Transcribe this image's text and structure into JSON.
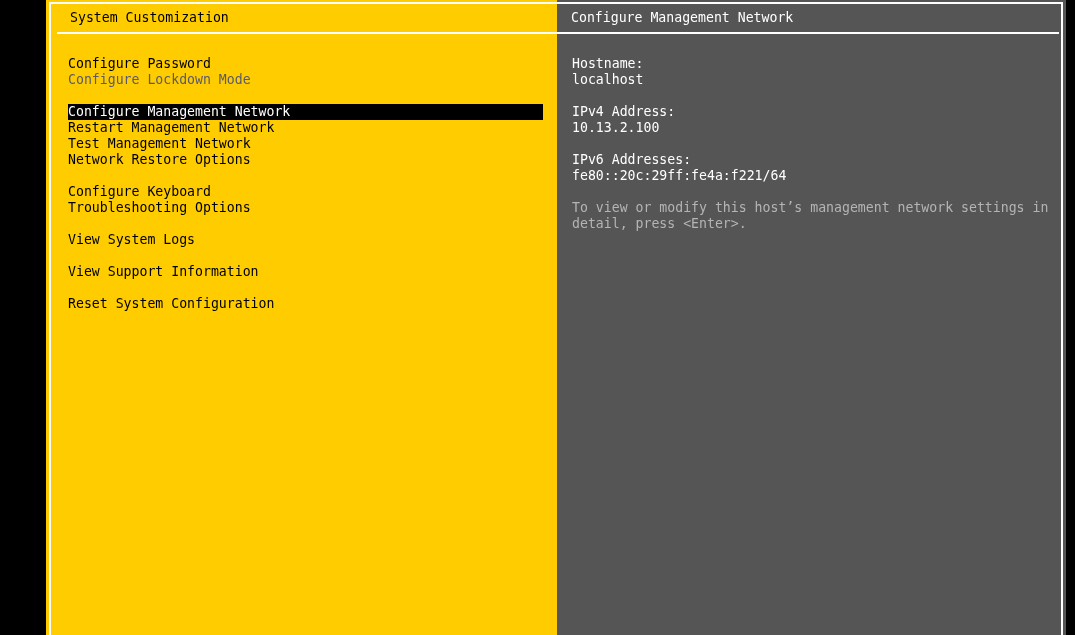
{
  "menu": {
    "title": "System Customization",
    "groups": [
      {
        "items": [
          {
            "label": "Configure Password",
            "disabled": false,
            "selected": false
          },
          {
            "label": "Configure Lockdown Mode",
            "disabled": true,
            "selected": false
          }
        ]
      },
      {
        "items": [
          {
            "label": "Configure Management Network",
            "disabled": false,
            "selected": true
          },
          {
            "label": "Restart Management Network",
            "disabled": false,
            "selected": false
          },
          {
            "label": "Test Management Network",
            "disabled": false,
            "selected": false
          },
          {
            "label": "Network Restore Options",
            "disabled": false,
            "selected": false
          }
        ]
      },
      {
        "items": [
          {
            "label": "Configure Keyboard",
            "disabled": false,
            "selected": false
          },
          {
            "label": "Troubleshooting Options",
            "disabled": false,
            "selected": false
          }
        ]
      },
      {
        "items": [
          {
            "label": "View System Logs",
            "disabled": false,
            "selected": false
          }
        ]
      },
      {
        "items": [
          {
            "label": "View Support Information",
            "disabled": false,
            "selected": false
          }
        ]
      },
      {
        "items": [
          {
            "label": "Reset System Configuration",
            "disabled": false,
            "selected": false
          }
        ]
      }
    ]
  },
  "details": {
    "title": "Configure Management Network",
    "fields": [
      {
        "label": "Hostname:",
        "value": "localhost"
      },
      {
        "label": "IPv4 Address:",
        "value": "10.13.2.100"
      },
      {
        "label": "IPv6 Addresses:",
        "value": "fe80::20c:29ff:fe4a:f221/64"
      }
    ],
    "hint": "To view or modify this host’s management network settings in detail, press <Enter>."
  }
}
